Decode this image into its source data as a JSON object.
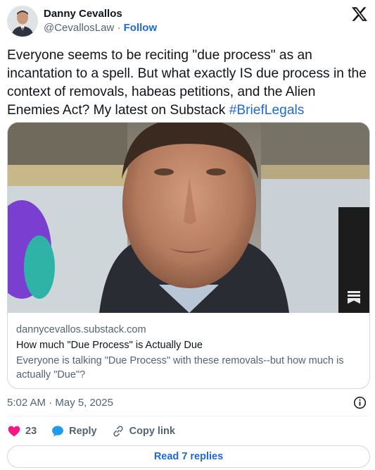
{
  "author": {
    "name": "Danny Cevallos",
    "handle": "@CevallosLaw",
    "separator": " · ",
    "follow_label": "Follow"
  },
  "tweet": {
    "text": "Everyone seems to be reciting \"due process\" as an incantation to a spell. But what exactly IS due process in the context of removals, habeas petitions, and the Alien Enemies Act? My latest on Substack ",
    "hashtag": "#BriefLegals"
  },
  "card": {
    "domain": "dannycevallos.substack.com",
    "title": "How much \"Due Process\" is Actually Due",
    "description": "Everyone is talking \"Due Process\" with these removals--but how much is actually \"Due\"?"
  },
  "timestamp": "5:02 AM · May 5, 2025",
  "actions": {
    "likes_count": "23",
    "reply_label": "Reply",
    "copy_link_label": "Copy link"
  },
  "read_replies_label": "Read 7 replies",
  "colors": {
    "link_blue": "#1d6ad1",
    "like_pink": "#f91880",
    "reply_blue": "#1d9bf0",
    "text_gray": "#536471"
  },
  "icons": [
    "x-logo-icon",
    "bookmark-icon",
    "info-icon",
    "heart-icon",
    "reply-bubble-icon",
    "link-icon"
  ]
}
